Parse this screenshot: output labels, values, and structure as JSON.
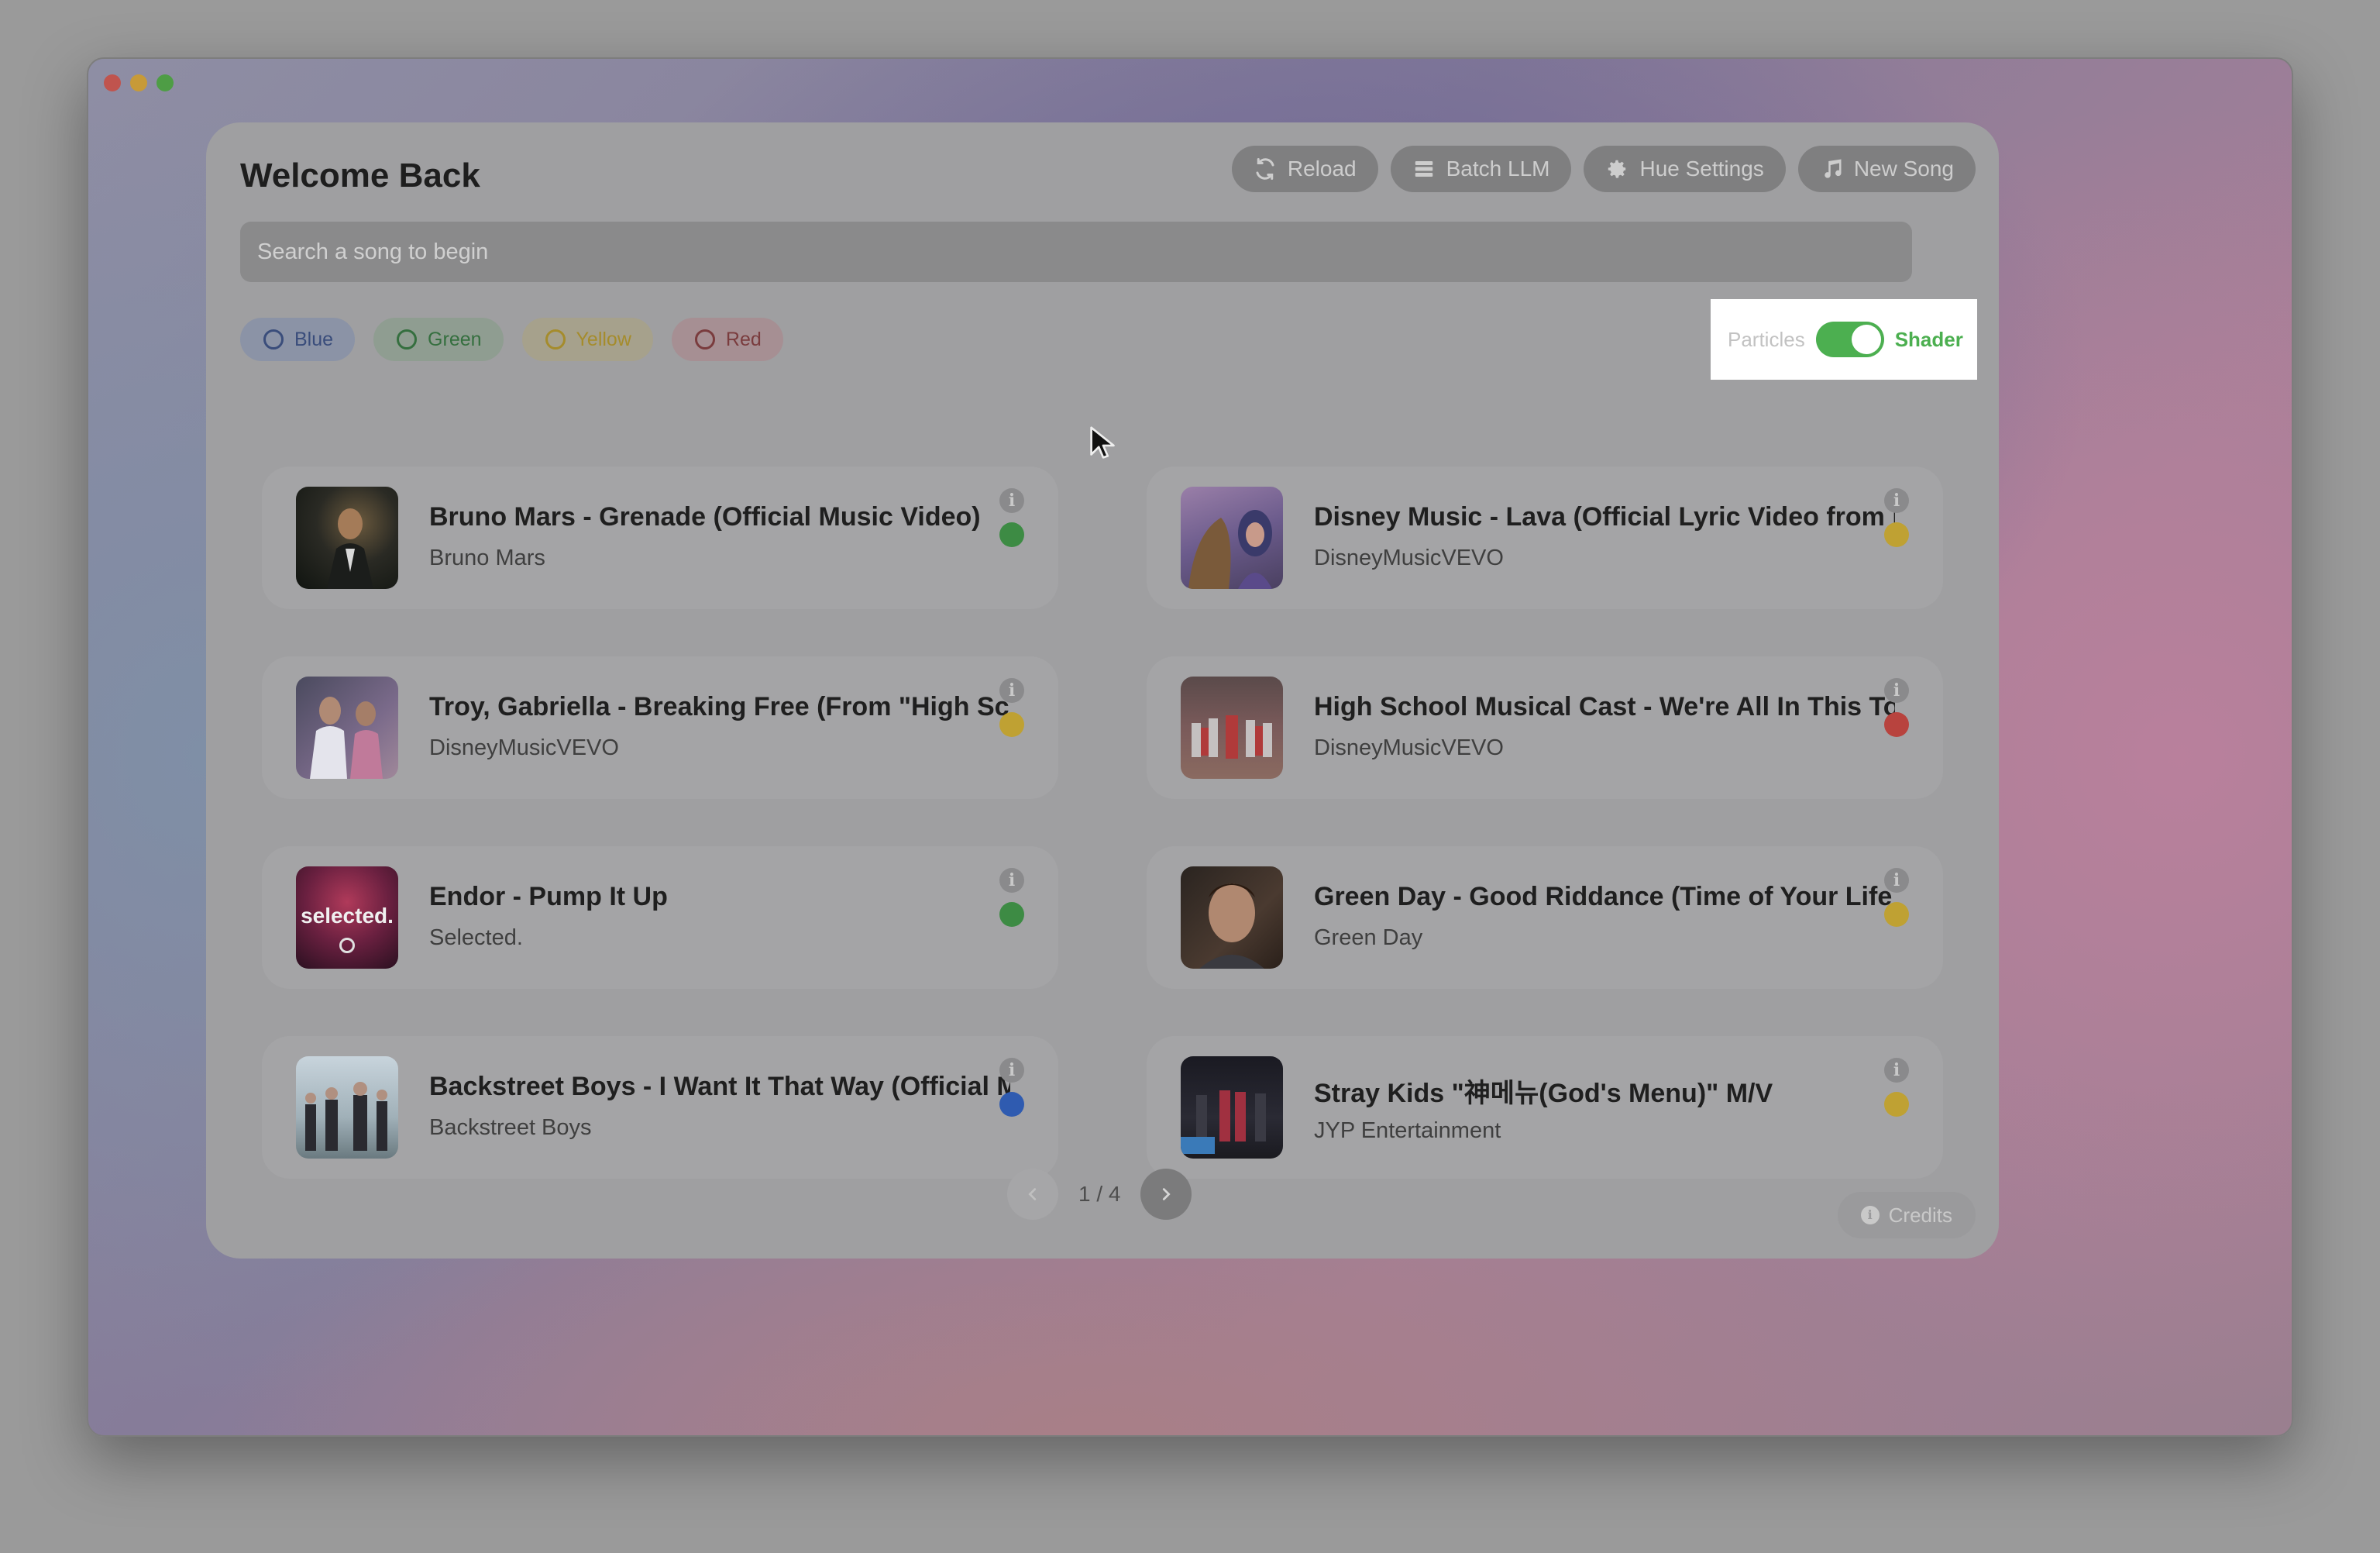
{
  "header": {
    "title": "Welcome Back",
    "actions": [
      {
        "label": "Reload",
        "icon": "refresh-icon"
      },
      {
        "label": "Batch LLM",
        "icon": "list-icon"
      },
      {
        "label": "Hue Settings",
        "icon": "gear-icon"
      },
      {
        "label": "New Song",
        "icon": "music-note-icon"
      }
    ]
  },
  "search": {
    "placeholder": "Search a song to begin",
    "value": ""
  },
  "filters": [
    {
      "label": "Blue",
      "color": "#3a4d7b"
    },
    {
      "label": "Green",
      "color": "#356f3f"
    },
    {
      "label": "Yellow",
      "color": "#a58c2c"
    },
    {
      "label": "Red",
      "color": "#7a3c3e"
    }
  ],
  "mode_toggle": {
    "off_label": "Particles",
    "on_label": "Shader",
    "state": "on"
  },
  "songs": [
    {
      "title": "Bruno Mars - Grenade (Official Music Video)",
      "artist": "Bruno Mars",
      "color": "green"
    },
    {
      "title": "Disney Music - Lava (Official Lyric Video from Lava)",
      "artist": "DisneyMusicVEVO",
      "color": "yellow"
    },
    {
      "title": "Troy, Gabriella - Breaking Free (From \"High School Musical\")",
      "artist": "DisneyMusicVEVO",
      "color": "yellow"
    },
    {
      "title": "High School Musical Cast - We're All In This Together",
      "artist": "DisneyMusicVEVO",
      "color": "red"
    },
    {
      "title": "Endor - Pump It Up",
      "artist": "Selected.",
      "color": "green"
    },
    {
      "title": "Green Day - Good Riddance (Time of Your Life)",
      "artist": "Green Day",
      "color": "yellow"
    },
    {
      "title": "Backstreet Boys - I Want It That Way (Official Music Video)",
      "artist": "Backstreet Boys",
      "color": "blue"
    },
    {
      "title": "Stray Kids \"神메뉴(God's Menu)\" M/V",
      "artist": "JYP Entertainment",
      "color": "yellow"
    }
  ],
  "thumb_text": {
    "selected": "selected."
  },
  "pagination": {
    "label": "1 / 4",
    "current": 1,
    "total": 4
  },
  "footer": {
    "credits_label": "Credits"
  }
}
